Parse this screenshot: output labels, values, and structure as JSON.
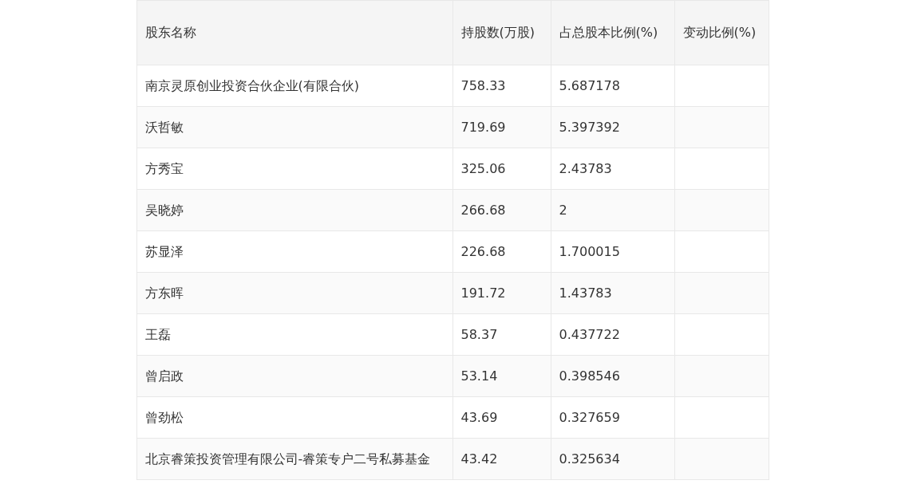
{
  "table": {
    "columns": [
      "股东名称",
      "持股数(万股)",
      "占总股本比例(%)",
      "变动比例(%)"
    ],
    "rows": [
      [
        "南京灵原创业投资合伙企业(有限合伙)",
        "758.33",
        "5.687178",
        ""
      ],
      [
        "沃哲敏",
        "719.69",
        "5.397392",
        ""
      ],
      [
        "方秀宝",
        "325.06",
        "2.43783",
        ""
      ],
      [
        "吴晓婷",
        "266.68",
        "2",
        ""
      ],
      [
        "苏显泽",
        "226.68",
        "1.700015",
        ""
      ],
      [
        "方东晖",
        "191.72",
        "1.43783",
        ""
      ],
      [
        "王磊",
        "58.37",
        "0.437722",
        ""
      ],
      [
        "曾启政",
        "53.14",
        "0.398546",
        ""
      ],
      [
        "曾劲松",
        "43.69",
        "0.327659",
        ""
      ],
      [
        "北京睿策投资管理有限公司-睿策专户二号私募基金",
        "43.42",
        "0.325634",
        ""
      ]
    ]
  }
}
